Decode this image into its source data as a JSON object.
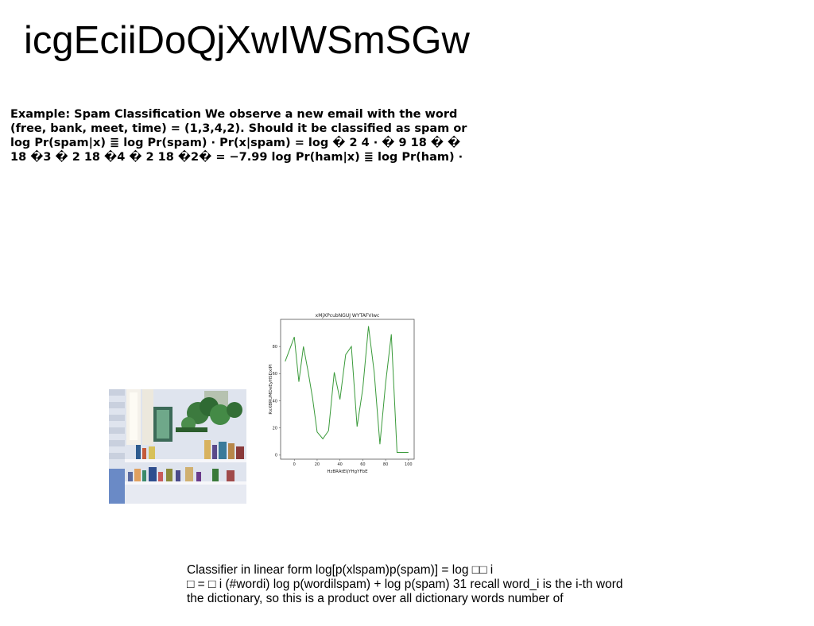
{
  "title": "icgEciiDoQjXwIWSmSGw",
  "spam_example": {
    "lines": [
      "Example: Spam Classification We observe a new email with the word",
      "(free, bank, meet, time) = (1,3,4,2). Should it be classified as spam or",
      "log Pr(spam|x) ≣ log Pr(spam) · Pr(x|spam) = log � 2 4 · � 9 18 � �",
      "18 �3 � 2 18 �4 � 2 18 �2� = −7.99 log Pr(ham|x) ≣ log Pr(ham) ·"
    ]
  },
  "photo": {
    "icon": "bookshelf-plants-photo"
  },
  "chart_data": {
    "type": "line",
    "title": "xMjXPcubNGUJ WYTAFVIwc",
    "xlabel": "HzBRAtEIjYHgYFbE",
    "ylabel": "RxXBRUMDeEyHSDxIPI",
    "x": [
      -8,
      0,
      4,
      8,
      12,
      16,
      20,
      25,
      30,
      35,
      40,
      45,
      50,
      55,
      60,
      65,
      70,
      75,
      80,
      85,
      90,
      95,
      100
    ],
    "series": [
      {
        "color": "#3a9a3a",
        "values": [
          69,
          87,
          54,
          80,
          62,
          42,
          17,
          12,
          18,
          61,
          41,
          74,
          80,
          21,
          49,
          95,
          61,
          8,
          53,
          89,
          2,
          2,
          2
        ]
      }
    ],
    "xlim": [
      -12,
      105
    ],
    "ylim": [
      -3,
      100
    ],
    "xticks": [
      "0",
      "20",
      "40",
      "60",
      "80",
      "100"
    ],
    "yticks": [
      "0",
      "20",
      "40",
      "60",
      "80"
    ],
    "grid": false
  },
  "classifier": {
    "lines": [
      "Classifier in linear form log[p(xlspam)p(spam)] = log □□ i",
      "□ = □ i (#wordi) log p(wordilspam) + log p(spam) 31 recall word_i is the i-th word",
      "the dictionary, so this is a product over all dictionary words number of"
    ]
  }
}
